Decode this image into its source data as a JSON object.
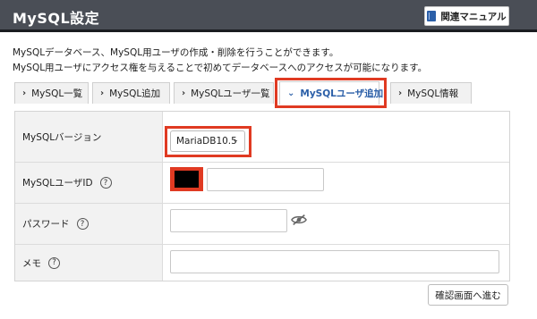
{
  "header": {
    "title": "MySQL設定",
    "manual_label": "関連マニュアル",
    "manual_icon": "book-icon"
  },
  "description": {
    "line1": "MySQLデータベース、MySQL用ユーザの作成・削除を行うことができます。",
    "line2": "MySQL用ユーザにアクセス権を与えることで初めてデータベースへのアクセスが可能になります。"
  },
  "tabs": [
    {
      "label": "MySQL一覧",
      "icon": "chevron-right-icon",
      "active": false
    },
    {
      "label": "MySQL追加",
      "icon": "chevron-right-icon",
      "active": false
    },
    {
      "label": "MySQLユーザ一覧",
      "icon": "chevron-right-icon",
      "active": false
    },
    {
      "label": "MySQLユーザ追加",
      "icon": "chevron-down-icon",
      "active": true
    },
    {
      "label": "MySQL情報",
      "icon": "chevron-right-icon",
      "active": false
    }
  ],
  "form": {
    "version": {
      "label": "MySQLバージョン",
      "selected": "MariaDB10.5"
    },
    "user_id": {
      "label": "MySQLユーザID",
      "help": "?",
      "value": ""
    },
    "password": {
      "label": "パスワード",
      "help": "?",
      "value": "",
      "toggle_icon": "eye-slash-icon"
    },
    "memo": {
      "label": "メモ",
      "help": "?",
      "value": ""
    }
  },
  "actions": {
    "confirm_label": "確認画面へ進む"
  },
  "colors": {
    "header_bg": "#4a4e56",
    "highlight": "#e03a22",
    "active_tab_text": "#2b5fa8"
  }
}
